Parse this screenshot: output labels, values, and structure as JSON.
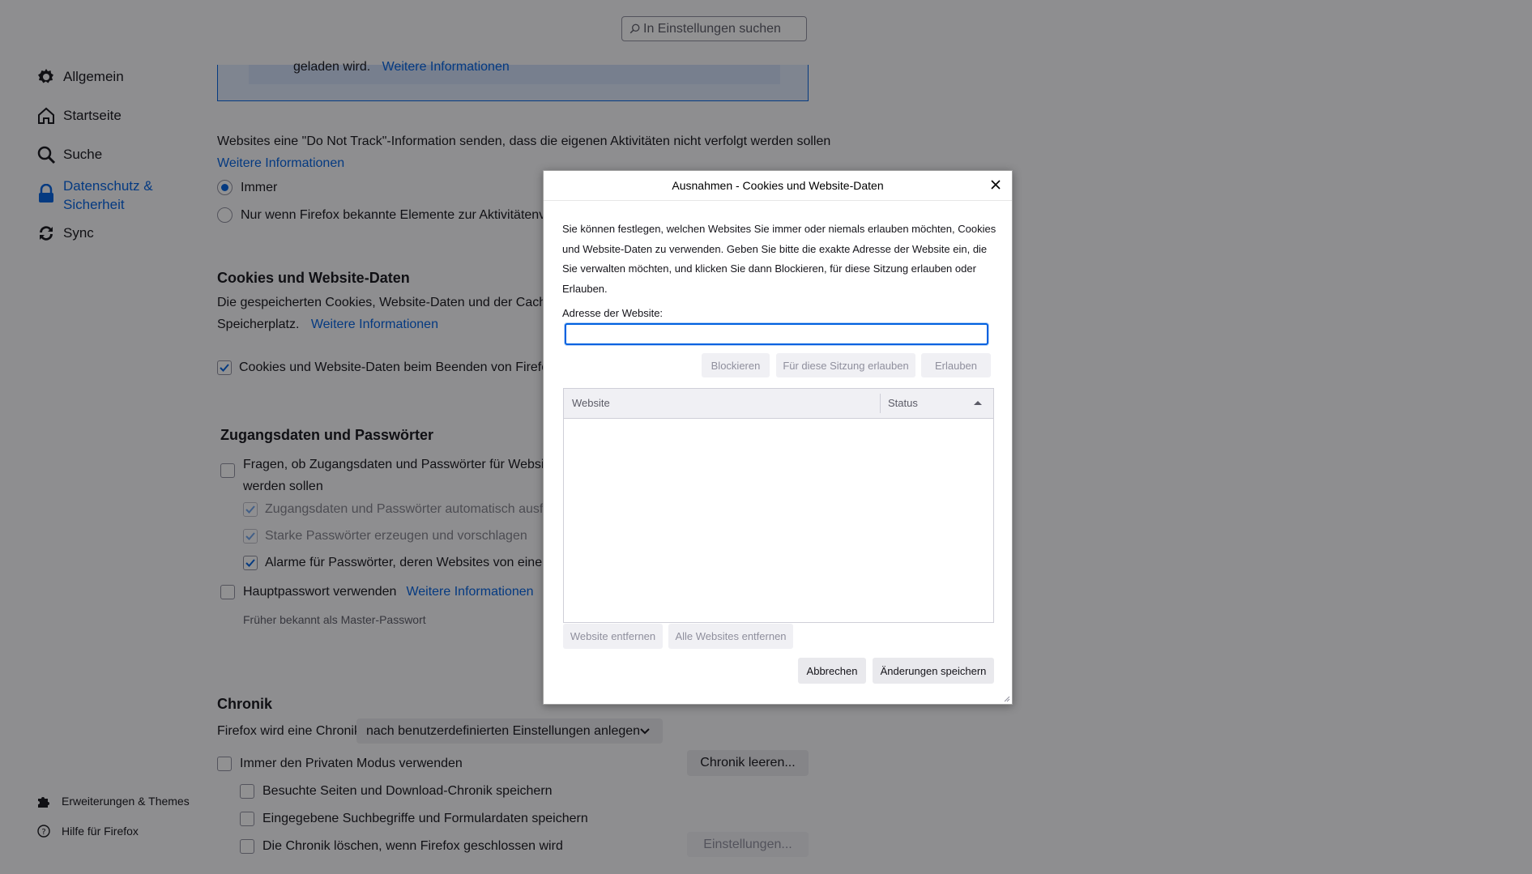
{
  "search": {
    "placeholder": "In Einstellungen suchen"
  },
  "sidebar": {
    "items": [
      {
        "label": "Allgemein",
        "icon": "gear-icon"
      },
      {
        "label": "Startseite",
        "icon": "home-icon"
      },
      {
        "label": "Suche",
        "icon": "search-icon"
      },
      {
        "label": "Datenschutz &",
        "label2": "Sicherheit",
        "icon": "lock-icon",
        "active": true
      },
      {
        "label": "Sync",
        "icon": "sync-icon"
      }
    ],
    "footer": [
      {
        "label": "Erweiterungen & Themes",
        "icon": "puzzle-icon"
      },
      {
        "label": "Hilfe für Firefox",
        "icon": "help-icon"
      }
    ]
  },
  "content": {
    "banner_text": "geladen wird.",
    "banner_link": "Weitere Informationen",
    "dnt_text": "Websites eine \"Do Not Track\"-Information senden, dass die eigenen Aktivitäten nicht verfolgt werden sollen",
    "dnt_link": "Weitere Informationen",
    "dnt_always": "Immer",
    "dnt_only": "Nur wenn Firefox bekannte Elemente zur Aktivitätenverfo",
    "cookies_heading": "Cookies und Website-Daten",
    "cookies_desc1": "Die gespeicherten Cookies, Website-Daten und der Cache be",
    "cookies_desc2": "Speicherplatz.",
    "cookies_link": "Weitere Informationen",
    "cookies_delete": "Cookies und Website-Daten beim Beenden von Firefox lö",
    "logins_heading": "Zugangsdaten und Passwörter",
    "logins_ask1": "Fragen, ob Zugangsdaten und Passwörter für Websites g",
    "logins_ask2": "werden sollen",
    "logins_autofill": "Zugangsdaten und Passwörter automatisch ausfüller",
    "logins_strong": "Starke Passwörter erzeugen und vorschlagen",
    "logins_alerts": "Alarme für Passwörter, deren Websites von einem D",
    "primary_pw": "Hauptpasswort verwenden",
    "primary_pw_link": "Weitere Informationen",
    "primary_pw_note": "Früher bekannt als Master-Passwort",
    "history_heading": "Chronik",
    "history_label": "Firefox wird eine Chronik",
    "history_select": "nach benutzerdefinierten Einstellungen anlegen",
    "history_private": "Immer den Privaten Modus verwenden",
    "history_clear_btn": "Chronik leeren...",
    "history_visited": "Besuchte Seiten und Download-Chronik speichern",
    "history_search": "Eingegebene Suchbegriffe und Formulardaten speichern",
    "history_clear_close": "Die Chronik löschen, wenn Firefox geschlossen wird",
    "history_settings_btn": "Einstellungen..."
  },
  "dialog": {
    "title": "Ausnahmen - Cookies und Website-Daten",
    "description": "Sie können festlegen, welchen Websites Sie immer oder niemals erlauben möchten, Cookies und Website-Daten zu verwenden. Geben Sie bitte die exakte Adresse der Website ein, die Sie verwalten möchten, und klicken Sie dann Blockieren, für diese Sitzung erlauben oder Erlauben.",
    "address_label": "Adresse der Website:",
    "address_value": "",
    "btn_block": "Blockieren",
    "btn_session": "Für diese Sitzung erlauben",
    "btn_allow": "Erlauben",
    "col_website": "Website",
    "col_status": "Status",
    "btn_remove": "Website entfernen",
    "btn_remove_all": "Alle Websites entfernen",
    "btn_cancel": "Abbrechen",
    "btn_save": "Änderungen speichern"
  },
  "colors": {
    "accent": "#0061e0",
    "overlay": "#0c0c0d"
  }
}
